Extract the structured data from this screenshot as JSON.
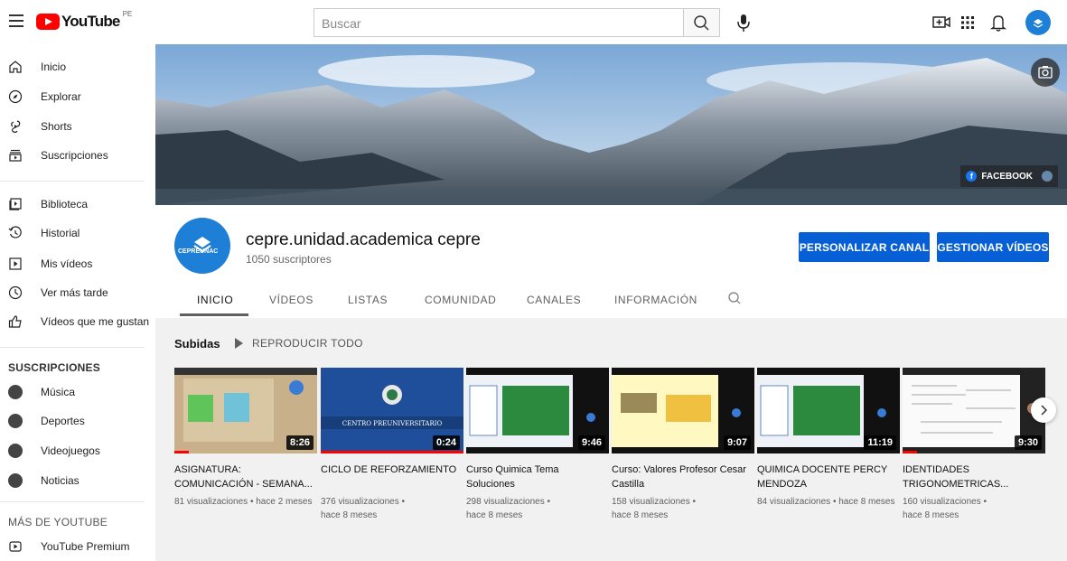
{
  "topbar": {
    "logo_text": "YouTube",
    "country_code": "PE",
    "search_placeholder": "Buscar",
    "icons": [
      "menu-icon",
      "search-icon",
      "mic-icon",
      "create-video-icon",
      "apps-grid-icon",
      "notifications-bell-icon"
    ]
  },
  "sidebar": {
    "main": [
      {
        "label": "Inicio",
        "icon": "home-icon"
      },
      {
        "label": "Explorar",
        "icon": "compass-icon"
      },
      {
        "label": "Shorts",
        "icon": "shorts-icon"
      },
      {
        "label": "Suscripciones",
        "icon": "subscriptions-icon"
      }
    ],
    "library": [
      {
        "label": "Biblioteca",
        "icon": "library-icon"
      },
      {
        "label": "Historial",
        "icon": "history-icon"
      },
      {
        "label": "Mis vídeos",
        "icon": "my-videos-icon"
      },
      {
        "label": "Ver más tarde",
        "icon": "watch-later-icon"
      },
      {
        "label": "Vídeos que me gustan",
        "icon": "thumbs-up-icon"
      }
    ],
    "subs_heading": "SUSCRIPCIONES",
    "subs": [
      {
        "label": "Música"
      },
      {
        "label": "Deportes"
      },
      {
        "label": "Videojuegos"
      },
      {
        "label": "Noticias"
      }
    ],
    "more_heading": "MÁS DE YOUTUBE",
    "more": [
      {
        "label": "YouTube Premium",
        "icon": "youtube-premium-icon"
      }
    ]
  },
  "banner": {
    "link_label": "FACEBOOK"
  },
  "channel": {
    "name": "cepre.unidad.academica cepre",
    "subscribers": "1050 suscriptores",
    "avatar_text": "CEPREUNAC",
    "customize_label": "PERSONALIZAR CANAL",
    "manage_label": "GESTIONAR VÍDEOS",
    "tabs": [
      "INICIO",
      "VÍDEOS",
      "LISTAS",
      "COMUNIDAD",
      "CANALES",
      "INFORMACIÓN"
    ],
    "active_tab": "INICIO"
  },
  "uploads": {
    "title": "Subidas",
    "play_all": "REPRODUCIR TODO",
    "videos": [
      {
        "title": "ASIGNATURA: COMUNICACIÓN - SEMANA...",
        "views": "81 visualizaciones",
        "age": "hace 2 meses",
        "duration": "8:26",
        "progress_pct": 10
      },
      {
        "title": "CICLO DE REFORZAMIENTO",
        "views": "376 visualizaciones",
        "age": "hace 8 meses",
        "duration": "0:24",
        "progress_pct": 100
      },
      {
        "title": "Curso Quimica Tema Soluciones",
        "views": "298 visualizaciones",
        "age": "hace 8 meses",
        "duration": "9:46",
        "progress_pct": 0
      },
      {
        "title": "Curso: Valores Profesor Cesar Castilla",
        "views": "158 visualizaciones",
        "age": "hace 8 meses",
        "duration": "9:07",
        "progress_pct": 0
      },
      {
        "title": "QUIMICA DOCENTE PERCY MENDOZA",
        "views": "84 visualizaciones",
        "age": "hace 8 meses",
        "duration": "11:19",
        "progress_pct": 0
      },
      {
        "title": "IDENTIDADES TRIGONOMETRICAS...",
        "views": "160 visualizaciones",
        "age": "hace 8 meses",
        "duration": "9:30",
        "progress_pct": 10
      }
    ]
  },
  "colors": {
    "brand_red": "#ff0000",
    "primary_blue": "#065fd4",
    "channel_blue": "#1e7fd6"
  }
}
